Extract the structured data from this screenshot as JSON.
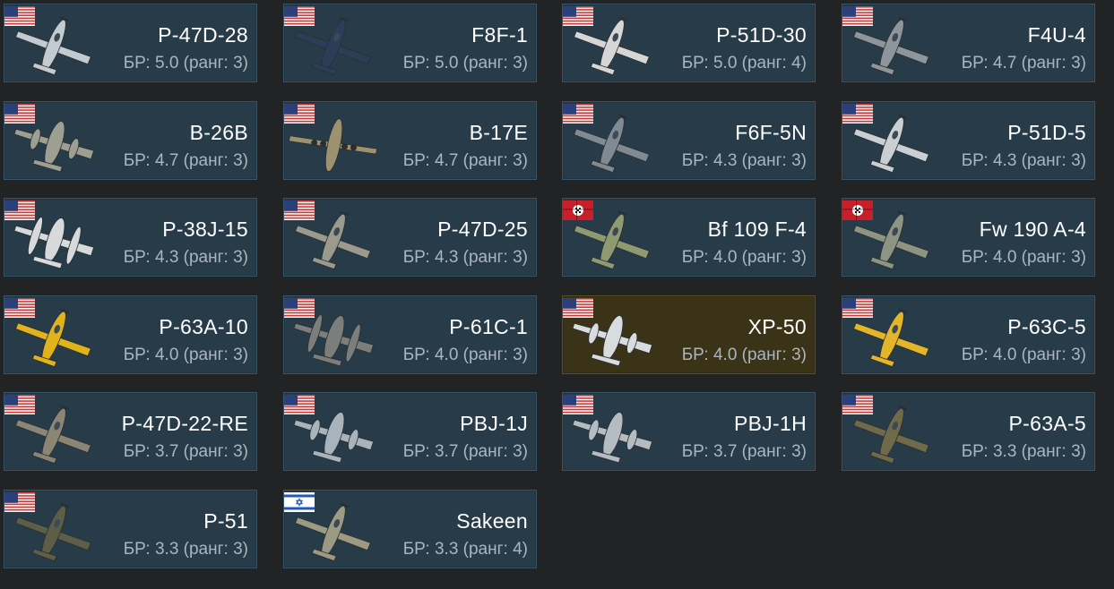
{
  "colors": {
    "card_bg": "#283b49",
    "card_border": "#38566a",
    "card_highlight_bg": "#3a3317",
    "name_text": "#ffffff",
    "br_text": "#aab6bf",
    "page_bg": "#222324"
  },
  "vehicles": [
    {
      "name": "P-47D-28",
      "br": "БР: 5.0 (ранг: 3)",
      "flag": "usa-flag-icon",
      "plane_color": "#c3cbd0",
      "plane_type": "single"
    },
    {
      "name": "F8F-1",
      "br": "БР: 5.0 (ранг: 3)",
      "flag": "usa-flag-icon",
      "plane_color": "#2c3d58",
      "plane_type": "single"
    },
    {
      "name": "P-51D-30",
      "br": "БР: 5.0 (ранг: 4)",
      "flag": "usa-flag-icon",
      "plane_color": "#d6d6d6",
      "plane_type": "single"
    },
    {
      "name": "F4U-4",
      "br": "БР: 4.7 (ранг: 3)",
      "flag": "usa-flag-icon",
      "plane_color": "#8e969c",
      "plane_type": "single"
    },
    {
      "name": "B-26B",
      "br": "БР: 4.7 (ранг: 3)",
      "flag": "usa-flag-icon",
      "plane_color": "#9d9f93",
      "plane_type": "twin"
    },
    {
      "name": "B-17E",
      "br": "БР: 4.7 (ранг: 3)",
      "flag": "usa-flag-icon",
      "plane_color": "#9d9270",
      "plane_type": "bomber"
    },
    {
      "name": "F6F-5N",
      "br": "БР: 4.3 (ранг: 3)",
      "flag": "usa-flag-icon",
      "plane_color": "#7f8a93",
      "plane_type": "single"
    },
    {
      "name": "P-51D-5",
      "br": "БР: 4.3 (ранг: 3)",
      "flag": "usa-flag-icon",
      "plane_color": "#c9cfd3",
      "plane_type": "single"
    },
    {
      "name": "P-38J-15",
      "br": "БР: 4.3 (ранг: 3)",
      "flag": "usa-flag-icon",
      "plane_color": "#d7dadc",
      "plane_type": "twinboom"
    },
    {
      "name": "P-47D-25",
      "br": "БР: 4.3 (ранг: 3)",
      "flag": "usa-flag-icon",
      "plane_color": "#9a9a8f",
      "plane_type": "single"
    },
    {
      "name": "Bf 109 F-4",
      "br": "БР: 4.0 (ранг: 3)",
      "flag": "germany-flag-icon",
      "plane_color": "#8f9a72",
      "plane_type": "single"
    },
    {
      "name": "Fw 190 A-4",
      "br": "БР: 4.0 (ранг: 3)",
      "flag": "germany-flag-icon",
      "plane_color": "#8d9483",
      "plane_type": "single"
    },
    {
      "name": "P-63A-10",
      "br": "БР: 4.0 (ранг: 3)",
      "flag": "usa-flag-icon",
      "plane_color": "#e0b21c",
      "plane_type": "single"
    },
    {
      "name": "P-61C-1",
      "br": "БР: 4.0 (ранг: 3)",
      "flag": "usa-flag-icon",
      "plane_color": "#7c7e7c",
      "plane_type": "twinboom"
    },
    {
      "name": "XP-50",
      "br": "БР: 4.0 (ранг: 3)",
      "flag": "usa-flag-icon",
      "plane_color": "#d9dcde",
      "plane_type": "twin",
      "highlight": true
    },
    {
      "name": "P-63C-5",
      "br": "БР: 4.0 (ранг: 3)",
      "flag": "usa-flag-icon",
      "plane_color": "#e3b52a",
      "plane_type": "single"
    },
    {
      "name": "P-47D-22-RE",
      "br": "БР: 3.7 (ранг: 3)",
      "flag": "usa-flag-icon",
      "plane_color": "#8b8576",
      "plane_type": "single"
    },
    {
      "name": "PBJ-1J",
      "br": "БР: 3.7 (ранг: 3)",
      "flag": "usa-flag-icon",
      "plane_color": "#a9b3bb",
      "plane_type": "twin"
    },
    {
      "name": "PBJ-1H",
      "br": "БР: 3.7 (ранг: 3)",
      "flag": "usa-flag-icon",
      "plane_color": "#b4bcc2",
      "plane_type": "twin"
    },
    {
      "name": "P-63A-5",
      "br": "БР: 3.3 (ранг: 3)",
      "flag": "usa-flag-icon",
      "plane_color": "#6f6a4a",
      "plane_type": "single"
    },
    {
      "name": "P-51",
      "br": "БР: 3.3 (ранг: 3)",
      "flag": "usa-flag-icon",
      "plane_color": "#5c5e48",
      "plane_type": "single"
    },
    {
      "name": "Sakeen",
      "br": "БР: 3.3 (ранг: 4)",
      "flag": "israel-flag-icon",
      "plane_color": "#9c9a82",
      "plane_type": "single"
    }
  ]
}
